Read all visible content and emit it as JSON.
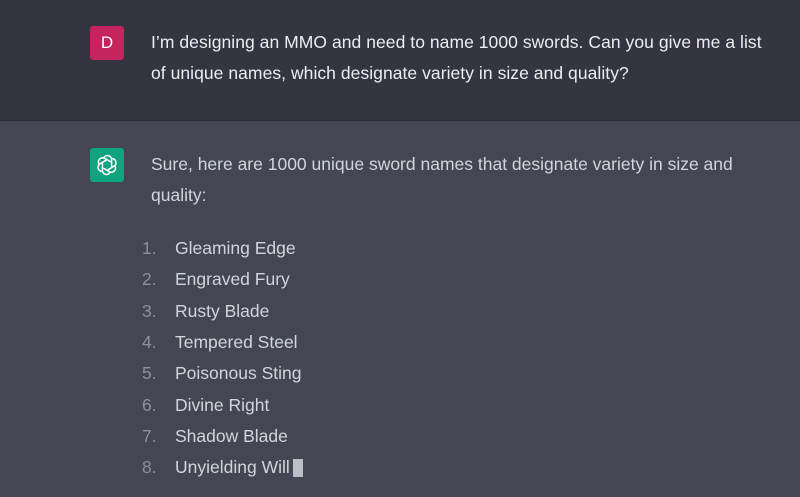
{
  "conversation": {
    "user_message": {
      "avatar_initial": "D",
      "avatar_color": "#c6245f",
      "text": "I’m designing an MMO and need to name 1000 swords.  Can you give me a list of unique names, which designate variety in size and quality?"
    },
    "assistant_message": {
      "avatar_icon": "openai-logo-icon",
      "avatar_color": "#10a37f",
      "intro": "Sure, here are 1000 unique sword names that designate variety in size and quality:",
      "items": [
        {
          "num": "1.",
          "text": "Gleaming Edge"
        },
        {
          "num": "2.",
          "text": "Engraved Fury"
        },
        {
          "num": "3.",
          "text": "Rusty Blade"
        },
        {
          "num": "4.",
          "text": "Tempered Steel"
        },
        {
          "num": "5.",
          "text": "Poisonous Sting"
        },
        {
          "num": "6.",
          "text": "Divine Right"
        },
        {
          "num": "7.",
          "text": "Shadow Blade"
        },
        {
          "num": "8.",
          "text": "Unyielding Will"
        }
      ],
      "streaming": true
    }
  },
  "colors": {
    "user_bg": "#343541",
    "assistant_bg": "#444654",
    "text": "#d1d5db"
  }
}
